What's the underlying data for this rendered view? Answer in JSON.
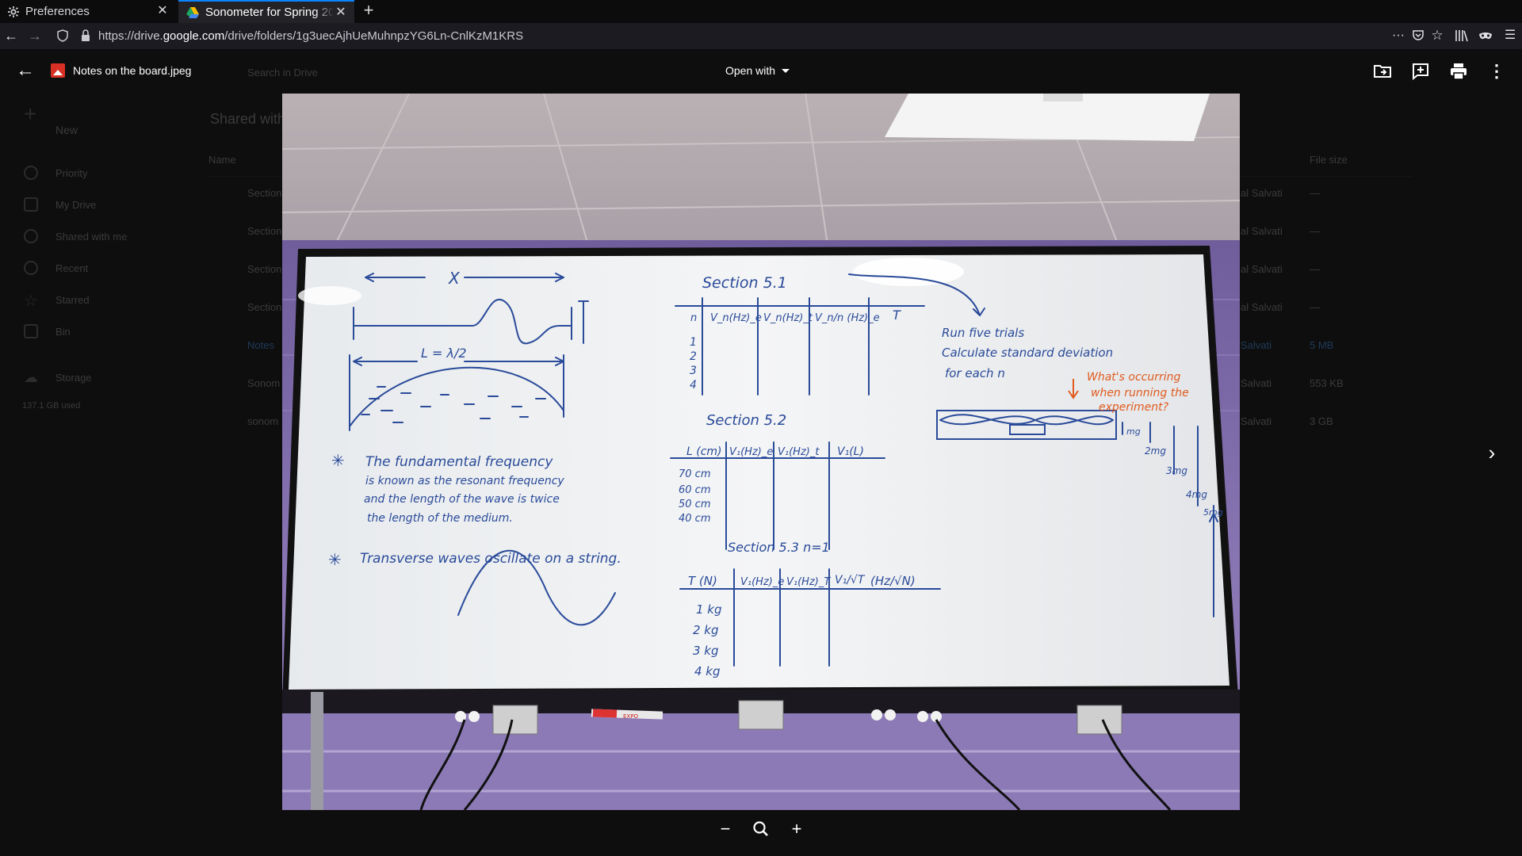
{
  "browser": {
    "tabs": [
      {
        "title": "Preferences",
        "icon": "gear-icon",
        "active": false
      },
      {
        "title": "Sonometer for Spring 20",
        "icon": "drive-icon",
        "active": true
      }
    ],
    "url_prefix": "https://drive.",
    "url_host": "google.com",
    "url_path": "/drive/folders/1g3uecAjhUeMuhnpzYG6Ln-CnlKzM1KRS"
  },
  "viewer": {
    "file_name": "Notes on the board.jpeg",
    "open_with_label": "Open with",
    "zoom": {
      "minus": "−",
      "search": "zoom-icon",
      "plus": "+"
    }
  },
  "drive_background": {
    "search_placeholder": "Search in Drive",
    "new_label": "New",
    "nav": [
      "Priority",
      "My Drive",
      "Shared with me",
      "Recent",
      "Starred",
      "Bin"
    ],
    "storage_label": "Storage",
    "storage_used": "137.1 GB used",
    "breadcrumb": "Shared with me",
    "col_name": "Name",
    "col_size": "File size",
    "rows": [
      {
        "name": "Section",
        "owner": "al Salvati",
        "size": "—"
      },
      {
        "name": "Section",
        "owner": "al Salvati",
        "size": "—"
      },
      {
        "name": "Section",
        "owner": "al Salvati",
        "size": "—"
      },
      {
        "name": "Section",
        "owner": "al Salvati",
        "size": "—"
      },
      {
        "name": "Notes",
        "owner": "Salvati",
        "size": "5 MB"
      },
      {
        "name": "Sonom",
        "owner": "Salvati",
        "size": "553 KB"
      },
      {
        "name": "sonom",
        "owner": "Salvati",
        "size": "3 GB"
      }
    ]
  },
  "whiteboard": {
    "x_label": "X",
    "l_label": "L = λ/2",
    "section51": "Section 5.1",
    "s51_headers": [
      "n",
      "V_n(Hz)_e",
      "V_n(Hz)_t",
      "V_n/n (Hz)_e",
      "T"
    ],
    "s51_rows": [
      "1",
      "2",
      "3",
      "4"
    ],
    "section52": "Section 5.2",
    "s52_headers": [
      "L (cm)",
      "V₁(Hz)_e",
      "V₁(Hz)_t",
      "V₁(L)"
    ],
    "s52_rows": [
      "70 cm",
      "60 cm",
      "50 cm",
      "40 cm"
    ],
    "section53": "Section 5.3   n=1",
    "s53_headers": [
      "T (N)",
      "V₁(Hz)_e",
      "V₁(Hz)_T",
      "V₁/√T",
      "(Hz/√N)"
    ],
    "s53_rows": [
      "1 kg",
      "2 kg",
      "3 kg",
      "4 kg"
    ],
    "note_fundamental": [
      "The fundamental frequency",
      "is known as the resonant frequency",
      "and the length of the wave is twice",
      "the length of the medium."
    ],
    "note_transverse": "Transverse waves oscillate on a string.",
    "todo": [
      "Run five trials",
      "Calculate standard deviation",
      "for each n"
    ],
    "orange_note": [
      "What's occurring",
      "when running the",
      "experiment?"
    ],
    "weights": [
      "mg",
      "2mg",
      "3mg",
      "4mg",
      "5mg"
    ],
    "marker_label": "EXPO"
  }
}
